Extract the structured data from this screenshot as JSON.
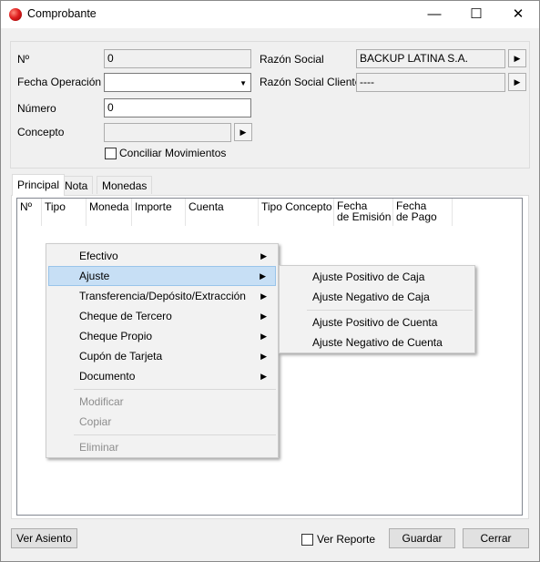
{
  "window": {
    "title": "Comprobante"
  },
  "form": {
    "nro_label": "Nº",
    "nro_value": "0",
    "fecha_label": "Fecha Operación",
    "fecha_value": "",
    "numero_label": "Número",
    "numero_value": "0",
    "concepto_label": "Concepto",
    "concepto_value": "",
    "conciliar_label": "Conciliar Movimientos",
    "razon_social_label": "Razón Social",
    "razon_social_value": "BACKUP LATINA S.A.",
    "razon_cliente_label": "Razón Social Cliente",
    "razon_cliente_value": "----"
  },
  "tabs": [
    "Principal",
    "Nota",
    "Monedas"
  ],
  "grid": {
    "columns": [
      {
        "line1": "Nº",
        "line2": ""
      },
      {
        "line1": "Tipo",
        "line2": ""
      },
      {
        "line1": "Moneda",
        "line2": ""
      },
      {
        "line1": "Importe",
        "line2": ""
      },
      {
        "line1": "Cuenta",
        "line2": ""
      },
      {
        "line1": "Tipo Concepto",
        "line2": ""
      },
      {
        "line1": "Fecha",
        "line2": "de Emisión"
      },
      {
        "line1": "Fecha",
        "line2": "de Pago"
      }
    ]
  },
  "context_menu": {
    "items": [
      {
        "label": "Efectivo",
        "submenu": true
      },
      {
        "label": "Ajuste",
        "submenu": true,
        "highlighted": true
      },
      {
        "label": "Transferencia/Depósito/Extracción",
        "submenu": true
      },
      {
        "label": "Cheque de Tercero",
        "submenu": true
      },
      {
        "label": "Cheque Propio",
        "submenu": true
      },
      {
        "label": "Cupón de Tarjeta",
        "submenu": true
      },
      {
        "label": "Documento",
        "submenu": true
      },
      {
        "label": "Modificar",
        "disabled": true
      },
      {
        "label": "Copiar",
        "disabled": true
      },
      {
        "label": "Eliminar",
        "disabled": true
      }
    ]
  },
  "submenu": {
    "items": [
      "Ajuste Positivo de Caja",
      "Ajuste Negativo de Caja",
      "Ajuste Positivo de Cuenta",
      "Ajuste Negativo de Cuenta"
    ]
  },
  "footer": {
    "ver_asiento": "Ver Asiento",
    "ver_reporte": "Ver Reporte",
    "guardar": "Guardar",
    "cerrar": "Cerrar"
  },
  "icons": {
    "submenu_arrow": "▶",
    "dropdown_arrow": "▼",
    "minimize": "—",
    "maximize": "☐",
    "close": "✕"
  },
  "colors": {
    "highlight": "#c7dff5",
    "highlight_border": "#99c4ea",
    "disabled_text": "#8d8d8d"
  }
}
